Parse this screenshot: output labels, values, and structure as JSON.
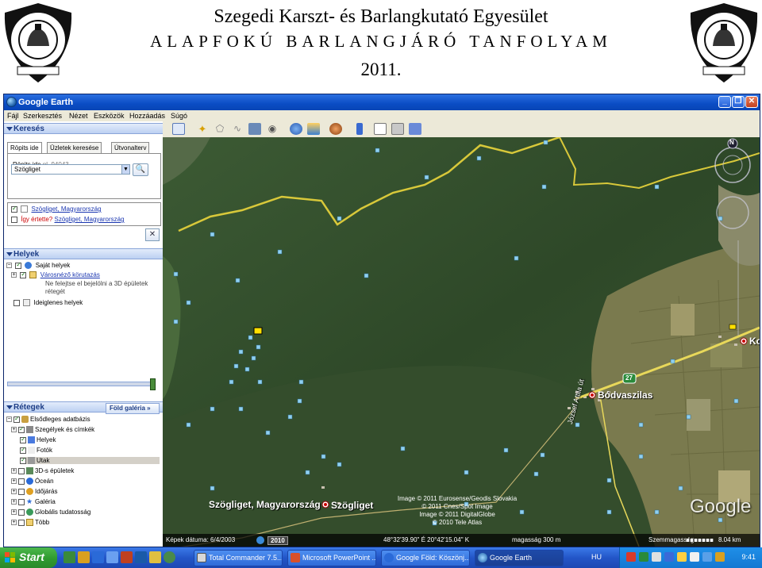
{
  "slide": {
    "title": "Szegedi Karszt- és Barlangkutató Egyesület",
    "subtitle": "ALAPFOKÚ BARLANGJÁRÓ TANFOLYAM",
    "year": "2011."
  },
  "window": {
    "title": "Google Earth",
    "menu": [
      "Fájl",
      "Szerkesztés",
      "Nézet",
      "Eszközök",
      "Hozzáadás",
      "Súgó"
    ]
  },
  "search": {
    "header": "Keresés",
    "tabs": [
      "Röpits ide",
      "Üzletek keresése",
      "Útvonalterv"
    ],
    "fly_label": "Röpits ide",
    "fly_hint": "pl. 94043",
    "input_value": "Szögliget",
    "result1": "Szögliget, Magyarország",
    "did_you_mean": "Így értette?",
    "result2": "Szögliget, Magyarország"
  },
  "places": {
    "header": "Helyek",
    "my_places": "Saját helyek",
    "tour": "Városnéző körutazás",
    "tour_note": "Ne felejtse el bejelölni a 3D épületek rétegét",
    "temp_places": "Ideiglenes helyek"
  },
  "layers": {
    "header": "Rétegek",
    "gallery_button": "Föld galéria",
    "items": [
      "Elsődleges adatbázis",
      "Szegélyek és címkék",
      "Helyek",
      "Fotók",
      "Utak",
      "3D-s épületek",
      "Óceán",
      "Időjárás",
      "Galéria",
      "Globális tudatosság",
      "Több"
    ]
  },
  "map": {
    "labels": {
      "szogliget_town": "Szögliget",
      "szogliget_search": "Szögliget, Magyarország",
      "bodvaszilas": "Bódvaszilas",
      "road": "József Attila út",
      "ko": "Ko",
      "route": "27"
    },
    "credits": [
      "Image © 2011 Eurosense/Geodis Slovakia",
      "© 2011 Cnes/Spot Image",
      "Image © 2011 DigitalGlobe",
      "© 2010 Tele Atlas"
    ],
    "google_logo": "Google",
    "status": {
      "date": "Képek dátuma: 6/4/2003",
      "year": "2010",
      "coords": "48°32'39.90\" É   20°42'15.04\" K",
      "elev": "magasság  300 m",
      "stream": "Szemmagasság",
      "eye_alt": "8.04 km"
    },
    "compass": "N"
  },
  "taskbar": {
    "start": "Start",
    "tasks": [
      "Total Commander 7.5...",
      "Microsoft PowerPoint ...",
      "Google Föld: Köszönj...",
      "Google Earth"
    ],
    "lang": "HU",
    "clock": "9:41"
  },
  "colors": {
    "xp_blue": "#2356c8",
    "start_green": "#2f9a2f",
    "border_yellow": "#d8c83a",
    "road_yellow": "#e8d85a",
    "marker_blue": "#8fd0f0"
  }
}
